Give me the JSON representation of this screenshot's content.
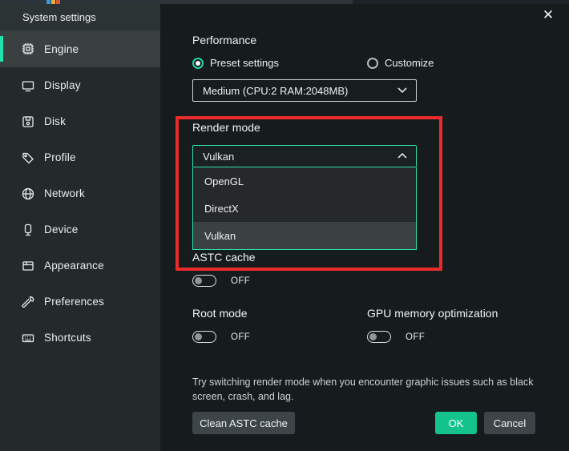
{
  "sidebar": {
    "title": "System settings",
    "items": [
      {
        "label": "Engine",
        "icon": "chip-icon",
        "selected": true
      },
      {
        "label": "Display",
        "icon": "monitor-icon",
        "selected": false
      },
      {
        "label": "Disk",
        "icon": "floppy-icon",
        "selected": false
      },
      {
        "label": "Profile",
        "icon": "tag-icon",
        "selected": false
      },
      {
        "label": "Network",
        "icon": "globe-icon",
        "selected": false
      },
      {
        "label": "Device",
        "icon": "device-icon",
        "selected": false
      },
      {
        "label": "Appearance",
        "icon": "window-icon",
        "selected": false
      },
      {
        "label": "Preferences",
        "icon": "wrench-icon",
        "selected": false
      },
      {
        "label": "Shortcuts",
        "icon": "keyboard-icon",
        "selected": false
      }
    ]
  },
  "main": {
    "close_icon": "✕",
    "performance": {
      "heading": "Performance",
      "radio_preset": {
        "label": "Preset settings",
        "selected": true
      },
      "radio_customize": {
        "label": "Customize",
        "selected": false
      },
      "preset_value": "Medium (CPU:2 RAM:2048MB)"
    },
    "render_mode": {
      "heading": "Render mode",
      "selected_value": "Vulkan",
      "options": [
        "OpenGL",
        "DirectX",
        "Vulkan"
      ],
      "highlighted_option": "Vulkan"
    },
    "astc_cache": {
      "heading": "ASTC cache",
      "state": "OFF"
    },
    "root_mode": {
      "heading": "Root mode",
      "state": "OFF"
    },
    "gpu_memory": {
      "heading": "GPU memory optimization",
      "state": "OFF"
    },
    "tip": "Try switching render mode when you encounter graphic issues such as black screen, crash, and lag.",
    "buttons": {
      "clean": "Clean ASTC cache",
      "ok": "OK",
      "cancel": "Cancel"
    }
  },
  "colors": {
    "accent_teal": "#1fe3ae",
    "ok_green": "#14c38b",
    "annotation_red": "#ea2b2b",
    "sidebar_bg": "#242a2a",
    "panel_bg": "#161b1d"
  }
}
